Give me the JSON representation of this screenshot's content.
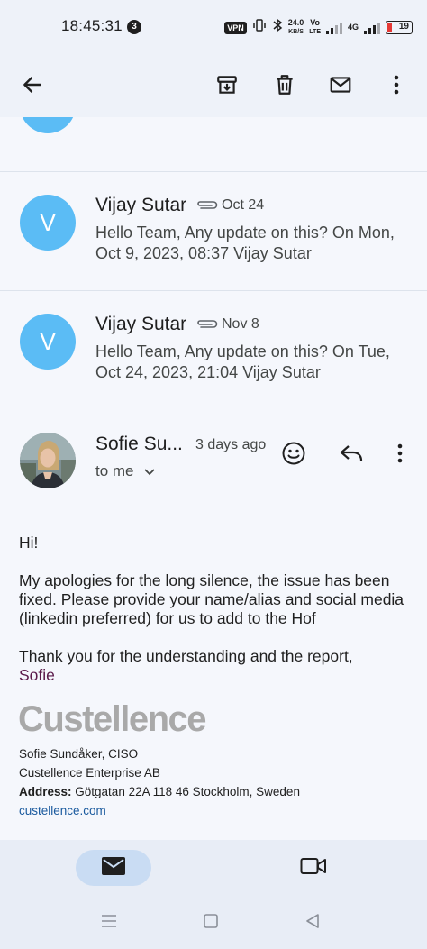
{
  "status_bar": {
    "time": "18:45:31",
    "notification_count": "3",
    "vpn": "VPN",
    "net_speed_value": "24.0",
    "net_speed_unit": "KB/S",
    "volte_top": "Vo",
    "volte_bottom": "LTE",
    "network_type": "4G",
    "battery_level": "19"
  },
  "toolbar": {
    "back_icon": "arrow-back-icon",
    "archive_icon": "archive-icon",
    "delete_icon": "trash-icon",
    "mark_unread_icon": "mail-icon",
    "more_icon": "more-vert-icon"
  },
  "collapsed_messages": [
    {
      "sender": "Vijay Sutar",
      "date": "Oct 24",
      "has_attachment": true,
      "avatar_letter": "V",
      "snippet": "Hello Team, Any update on this? On Mon, Oct 9, 2023, 08:37 Vijay Sutar"
    },
    {
      "sender": "Vijay Sutar",
      "date": "Nov 8",
      "has_attachment": true,
      "avatar_letter": "V",
      "snippet": "Hello Team, Any update on this? On Tue, Oct 24, 2023, 21:04 Vijay Sutar"
    }
  ],
  "expanded_message": {
    "sender": "Sofie Su...",
    "date": "3 days ago",
    "recipient": "to me",
    "body": {
      "greeting": "Hi!",
      "paragraph1": "My apologies for the long silence, the issue has been fixed. Please provide your name/alias and social media (linkedin preferred) for us to add to the Hof",
      "paragraph2": "Thank you for the understanding and the report,",
      "sign_name": "Sofie"
    },
    "signature": {
      "logo": "Custellence",
      "name_title": "Sofie Sundåker, CISO",
      "company": "Custellence Enterprise AB",
      "address_label": "Address:",
      "address": "Götgatan 22A 118 46 Stockholm, Sweden",
      "website": "custellence.com"
    }
  },
  "colors": {
    "avatar": "#5bbcf5",
    "background": "#eef2f9",
    "nav_active": "#c9dcf3",
    "link": "#1a5a9e",
    "logo": "#a9a9a9"
  }
}
